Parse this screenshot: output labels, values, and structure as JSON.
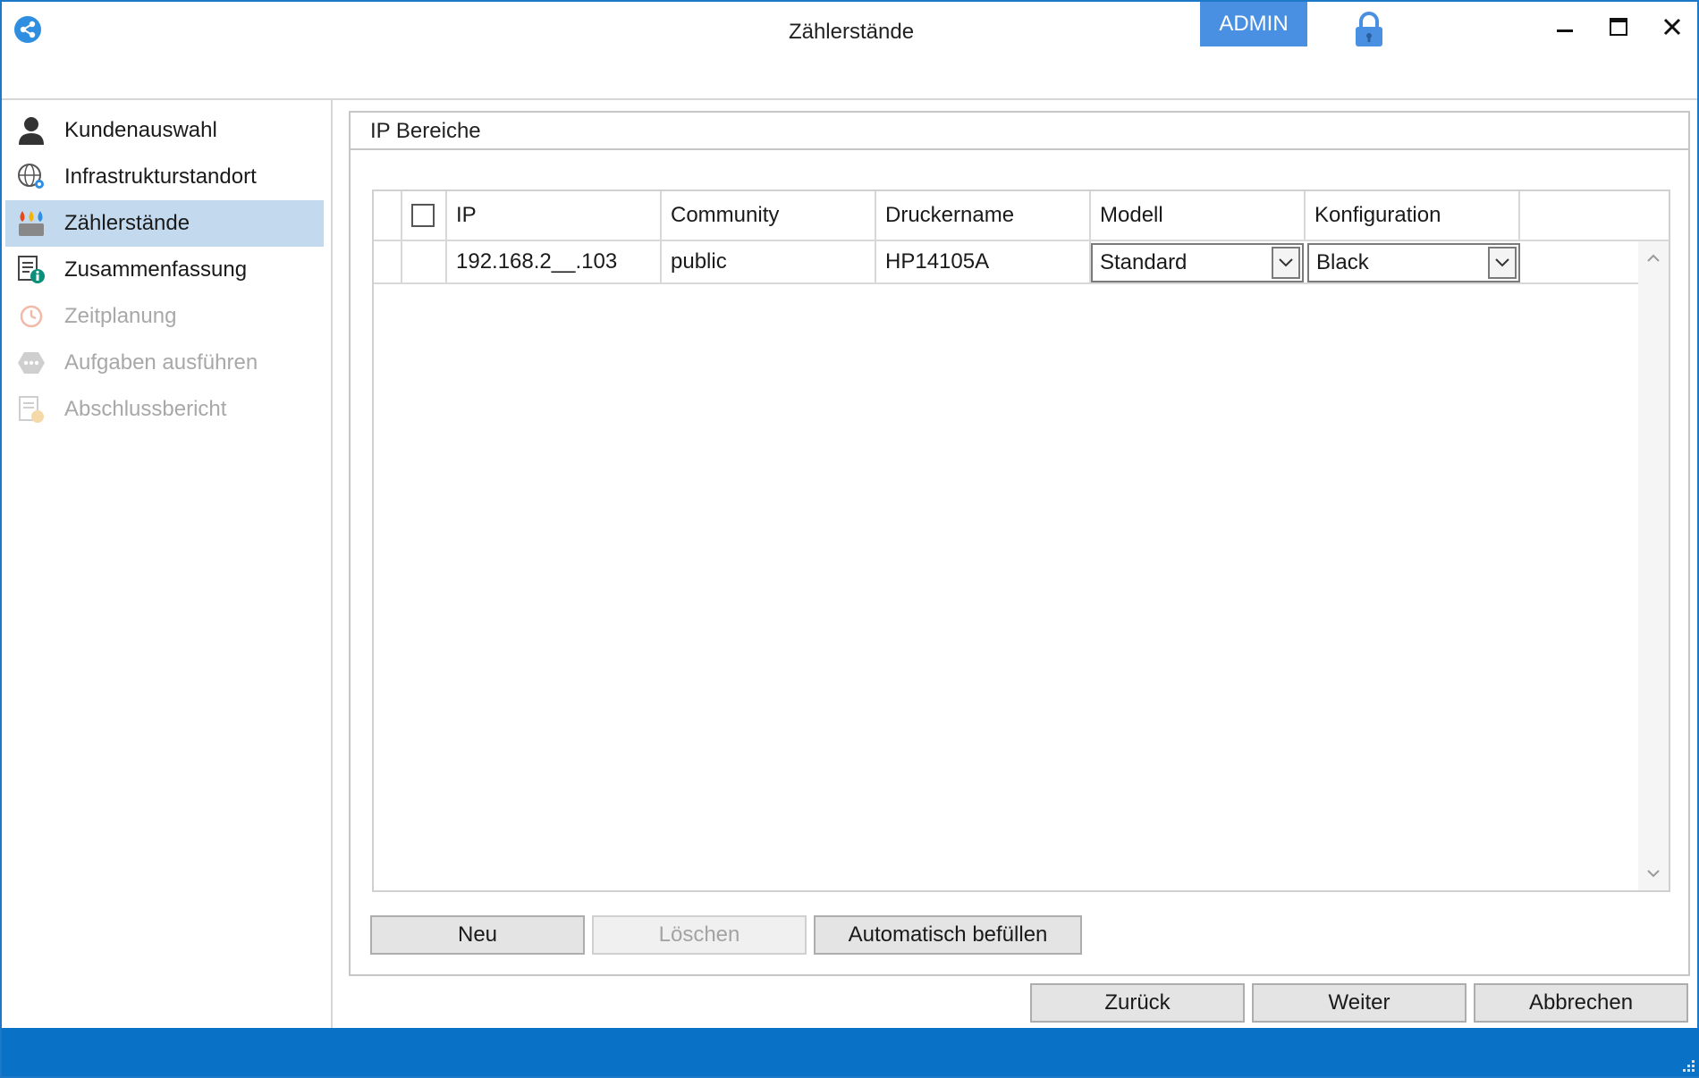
{
  "window": {
    "title": "Zählerstände",
    "admin_label": "ADMIN"
  },
  "sidebar": {
    "items": [
      {
        "label": "Kundenauswahl",
        "state": "normal",
        "icon": "user-icon"
      },
      {
        "label": "Infrastrukturstandort",
        "state": "normal",
        "icon": "globe-location-icon"
      },
      {
        "label": "Zählerstände",
        "state": "active",
        "icon": "ink-drops-icon"
      },
      {
        "label": "Zusammenfassung",
        "state": "normal",
        "icon": "document-info-icon"
      },
      {
        "label": "Zeitplanung",
        "state": "disabled",
        "icon": "clock-icon"
      },
      {
        "label": "Aufgaben ausführen",
        "state": "disabled",
        "icon": "ellipsis-icon"
      },
      {
        "label": "Abschlussbericht",
        "state": "disabled",
        "icon": "report-icon"
      }
    ]
  },
  "group": {
    "title": "IP Bereiche"
  },
  "grid": {
    "columns": [
      "IP",
      "Community",
      "Druckername",
      "Modell",
      "Konfiguration"
    ],
    "rows": [
      {
        "ip": "192.168.2__.103",
        "community": "public",
        "druckername": "HP14105A",
        "modell": "Standard",
        "konfiguration": "Black"
      }
    ]
  },
  "buttons": {
    "neu": "Neu",
    "loeschen": "Löschen",
    "auto": "Automatisch befüllen",
    "zurueck": "Zurück",
    "weiter": "Weiter",
    "abbrechen": "Abbrechen"
  },
  "colors": {
    "accent": "#0a72c6",
    "admin_badge": "#4a90e2",
    "active_nav": "#c3d9ee"
  }
}
